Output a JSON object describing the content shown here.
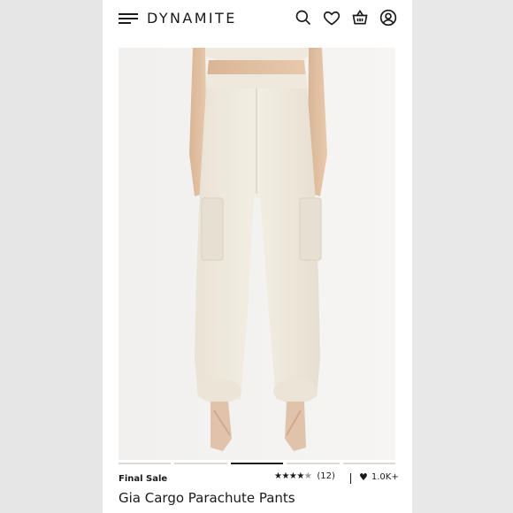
{
  "header": {
    "brand": "DYNAMITE",
    "icons": [
      "menu-icon",
      "search-icon",
      "heart-icon",
      "basket-icon",
      "user-icon"
    ]
  },
  "product": {
    "badge": "Final Sale",
    "name": "Gia Cargo Parachute Pants",
    "rating_count": "(12)",
    "likes": "1.0K+",
    "stars_filled": 4.5,
    "image_description_color": "#f3f2f0"
  },
  "carousel": {
    "total": 5,
    "active_index": 2
  },
  "colors": {
    "brand_text": "#1a1a1a",
    "background": "#ffffff",
    "side_bg": "#e8e8e8"
  }
}
